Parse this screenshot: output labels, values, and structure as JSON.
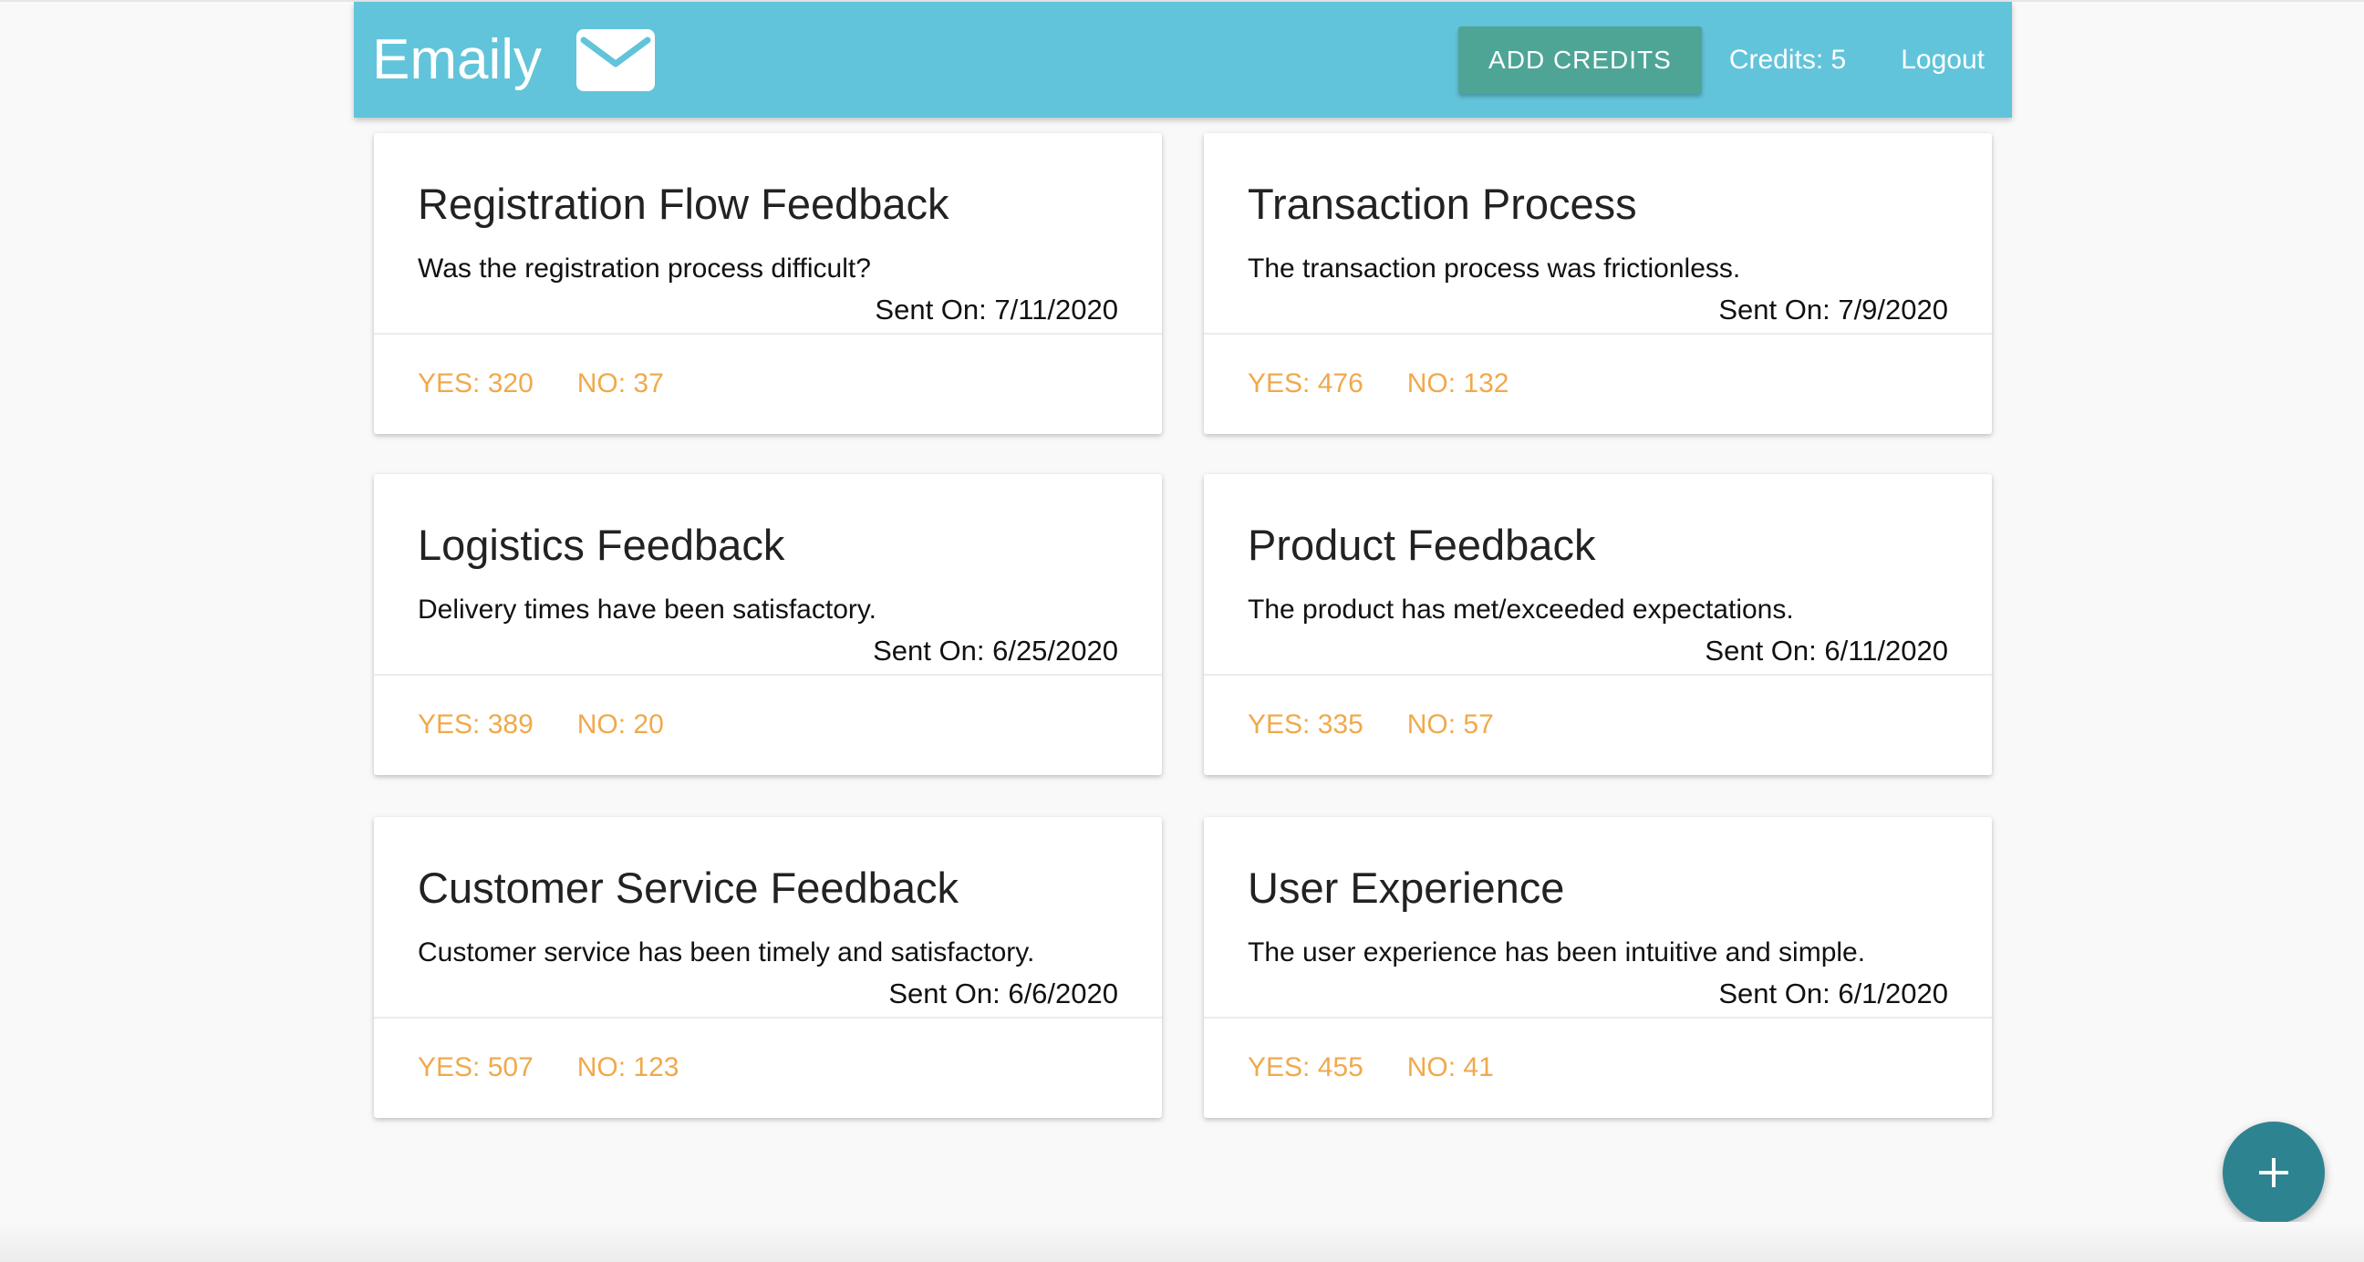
{
  "navbar": {
    "brand": "Emaily",
    "brand_icon": "mail-icon",
    "add_credits_label": "ADD CREDITS",
    "credits_label": "Credits: 5",
    "logout_label": "Logout",
    "bg_color": "#62c4da",
    "button_color": "#4ea596"
  },
  "surveys": [
    {
      "title": "Registration Flow Feedback",
      "body": "Was the registration process difficult?",
      "sent_on": "Sent On: 7/11/2020",
      "yes": "YES: 320",
      "no": "NO: 37"
    },
    {
      "title": "Transaction Process",
      "body": "The transaction process was frictionless.",
      "sent_on": "Sent On: 7/9/2020",
      "yes": "YES: 476",
      "no": "NO: 132"
    },
    {
      "title": "Logistics Feedback",
      "body": "Delivery times have been satisfactory.",
      "sent_on": "Sent On: 6/25/2020",
      "yes": "YES: 389",
      "no": "NO: 20"
    },
    {
      "title": "Product Feedback",
      "body": "The product has met/exceeded expectations.",
      "sent_on": "Sent On: 6/11/2020",
      "yes": "YES: 335",
      "no": "NO: 57"
    },
    {
      "title": "Customer Service Feedback",
      "body": "Customer service has been timely and satisfactory.",
      "sent_on": "Sent On: 6/6/2020",
      "yes": "YES: 507",
      "no": "NO: 123"
    },
    {
      "title": "User Experience",
      "body": "The user experience has been intuitive and simple.",
      "sent_on": "Sent On: 6/1/2020",
      "yes": "YES: 455",
      "no": "NO: 41"
    }
  ],
  "fab": {
    "icon": "plus-icon",
    "color": "#2e8390"
  },
  "accent_color": "#f0a94c"
}
